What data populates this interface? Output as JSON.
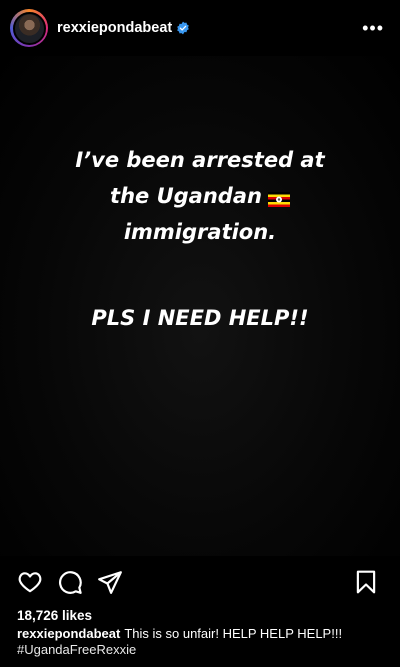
{
  "header": {
    "username": "rexxiepondabeat",
    "verified": true,
    "more_icon": "more-horizontal-icon",
    "more_label": "•••"
  },
  "post": {
    "text_lines": [
      "I’ve been arrested at",
      "the Ugandan",
      "immigration."
    ],
    "flag": "uganda-flag-emoji",
    "help_text": "PLS I NEED HELP!!",
    "background": "#000000"
  },
  "actions": {
    "like_icon": "heart-icon",
    "comment_icon": "comment-icon",
    "share_icon": "send-icon",
    "save_icon": "bookmark-icon"
  },
  "likes": "18,726 likes",
  "caption": {
    "username": "rexxiepondabeat",
    "text": "This is so unfair! HELP HELP HELP!!!",
    "hashtag": "#UgandaFreeRexxie"
  },
  "colors": {
    "verified": "#3897f0",
    "text": "#ffffff"
  }
}
